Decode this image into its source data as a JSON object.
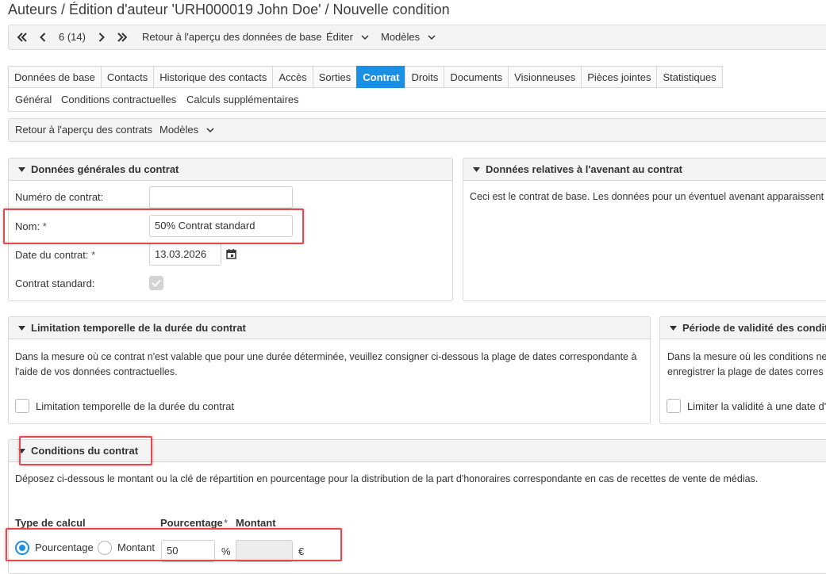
{
  "page": {
    "title": "Auteurs / Édition d'auteur 'URH000019 John Doe' / Nouvelle condition"
  },
  "toolbar": {
    "record_position": "6 (14)",
    "back_to_overview": "Retour à l'aperçu des données de base",
    "edit_menu": "Éditer",
    "templates_menu": "Modèles"
  },
  "tabs": [
    {
      "label": "Données de base",
      "active": false
    },
    {
      "label": "Contacts",
      "active": false
    },
    {
      "label": "Historique des contacts",
      "active": false
    },
    {
      "label": "Accès",
      "active": false
    },
    {
      "label": "Sorties",
      "active": false
    },
    {
      "label": "Contrat",
      "active": true
    },
    {
      "label": "Droits",
      "active": false
    },
    {
      "label": "Documents",
      "active": false
    },
    {
      "label": "Visionneuses",
      "active": false
    },
    {
      "label": "Pièces jointes",
      "active": false
    },
    {
      "label": "Statistiques",
      "active": false
    }
  ],
  "subtabs": [
    "Général",
    "Conditions contractuelles",
    "Calculs supplémentaires"
  ],
  "contract_bar": {
    "back_to_contracts": "Retour à l'aperçu des contrats",
    "templates_menu": "Modèles"
  },
  "general_panel": {
    "title": "Données générales du contrat",
    "contract_number_label": "Numéro de contrat:",
    "contract_number_value": "",
    "name_label": "Nom:",
    "name_value": "50% Contrat standard",
    "date_label": "Date du contrat:",
    "date_value": "13.03.2026",
    "standard_label": "Contrat standard:",
    "standard_checked": true,
    "required_marker": "*"
  },
  "amendment_panel": {
    "title": "Données relatives à l'avenant au contrat",
    "text": "Ceci est le contrat de base. Les données pour un éventuel avenant apparaissent"
  },
  "time_limit_panel": {
    "title": "Limitation temporelle de la durée du contrat",
    "text": "Dans la mesure où ce contrat n'est valable que pour une durée déterminée, veuillez consigner ci-dessous la plage de dates correspondante à l'aide de vos données contractuelles.",
    "checkbox_label": "Limitation temporelle de la durée du contrat",
    "checked": false
  },
  "validity_panel": {
    "title": "Période de validité des conditio",
    "text_line1": "Dans la mesure où les conditions ne",
    "text_line2": "enregistrer la plage de dates corres",
    "checkbox_label": "Limiter la validité à une date d'a",
    "checked": false
  },
  "conditions_panel": {
    "title": "Conditions du contrat",
    "text": "Déposez ci-dessous le montant ou la clé de répartition en pourcentage pour la distribution de la part d'honoraires correspondante en cas de recettes de vente de médias.",
    "calc_type_header": "Type de calcul",
    "percentage_header": "Pourcentage",
    "amount_header": "Montant",
    "required_marker": "*",
    "option_percentage": "Pourcentage",
    "option_amount": "Montant",
    "selected_option": "Pourcentage",
    "percentage_value": "50",
    "percent_unit": "%",
    "amount_value": "",
    "currency_unit": "€"
  },
  "colors": {
    "accent": "#1a8fe3",
    "highlight": "#e5484d",
    "panel_header": "#f4f4f4",
    "border": "#d8d8d8"
  }
}
